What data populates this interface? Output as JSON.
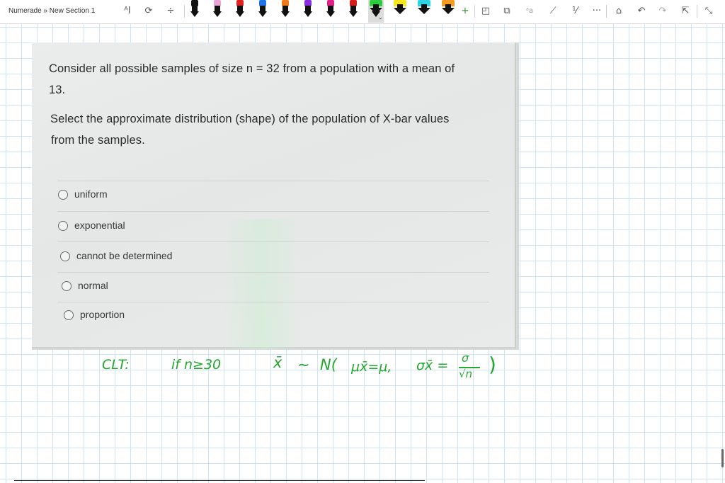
{
  "toolbar": {
    "breadcrumb": "Numerade » New Section 1",
    "left_tools": [
      {
        "icon": "text-select-icon",
        "glyph": "ᴬI"
      },
      {
        "icon": "lasso-select-icon",
        "glyph": "⟳"
      },
      {
        "icon": "insert-space-icon",
        "glyph": "÷"
      }
    ],
    "pens": [
      {
        "icon": "pen-black-icon",
        "color": "#111111"
      },
      {
        "icon": "pen-pink-icon",
        "color": "#e8a3d6"
      },
      {
        "icon": "pen-red-icon",
        "color": "#e02020"
      },
      {
        "icon": "pen-blue-icon",
        "color": "#1e73e8"
      },
      {
        "icon": "pen-orange-icon",
        "color": "#f07a1a"
      },
      {
        "icon": "pen-purple-icon",
        "color": "#8a2be2"
      },
      {
        "icon": "pen-magenta-icon",
        "color": "#e0208a"
      },
      {
        "icon": "pen-red2-icon",
        "color": "#d81b1b"
      },
      {
        "icon": "pen-green-icon",
        "color": "#1f9d3a",
        "selected": true
      }
    ],
    "highlighters": [
      {
        "icon": "highlighter-green-icon",
        "color": "#2ecc40"
      },
      {
        "icon": "highlighter-yellow-icon",
        "color": "#f5e71c"
      },
      {
        "icon": "highlighter-cyan-icon",
        "color": "#2fd3e8"
      },
      {
        "icon": "highlighter-orange-icon",
        "color": "#f29c1f"
      }
    ],
    "right_tools": [
      {
        "icon": "add-pen-icon",
        "glyph": "+"
      },
      {
        "icon": "shapes-icon",
        "glyph": "◰"
      },
      {
        "icon": "ink-to-shape-icon",
        "glyph": "⧉"
      },
      {
        "icon": "ink-to-text-icon",
        "glyph": "ᵃa"
      },
      {
        "icon": "ruler-icon",
        "glyph": "⟋"
      },
      {
        "icon": "math-icon",
        "glyph": "⅟"
      },
      {
        "icon": "more-icon",
        "glyph": "···"
      },
      {
        "icon": "touch-draw-icon",
        "glyph": "⌂"
      },
      {
        "icon": "undo-icon",
        "glyph": "↶"
      },
      {
        "icon": "redo-icon",
        "glyph": "↷"
      },
      {
        "icon": "replay-icon",
        "glyph": "⇱"
      },
      {
        "icon": "fullscreen-icon",
        "glyph": "⤡"
      }
    ]
  },
  "question": {
    "line1": "Consider all possible samples of size n = 32 from a population with a mean of",
    "line2": "13.",
    "line3": "Select the approximate distribution (shape) of the population of X-bar values",
    "line4": "from the samples.",
    "options": [
      "uniform",
      "exponential",
      "cannot be determined",
      "normal",
      "proportion"
    ]
  },
  "handwriting": {
    "clt": "CLT:",
    "condition": "if n≥30",
    "xbar": "x̄",
    "tilde": "∼",
    "normal_open": "N(",
    "mu": "μx̄=μ,",
    "sigma": "σx̄ =",
    "sigma_num": "σ",
    "sigma_den": "√n",
    "close": ")",
    "color": "#22a82e"
  }
}
